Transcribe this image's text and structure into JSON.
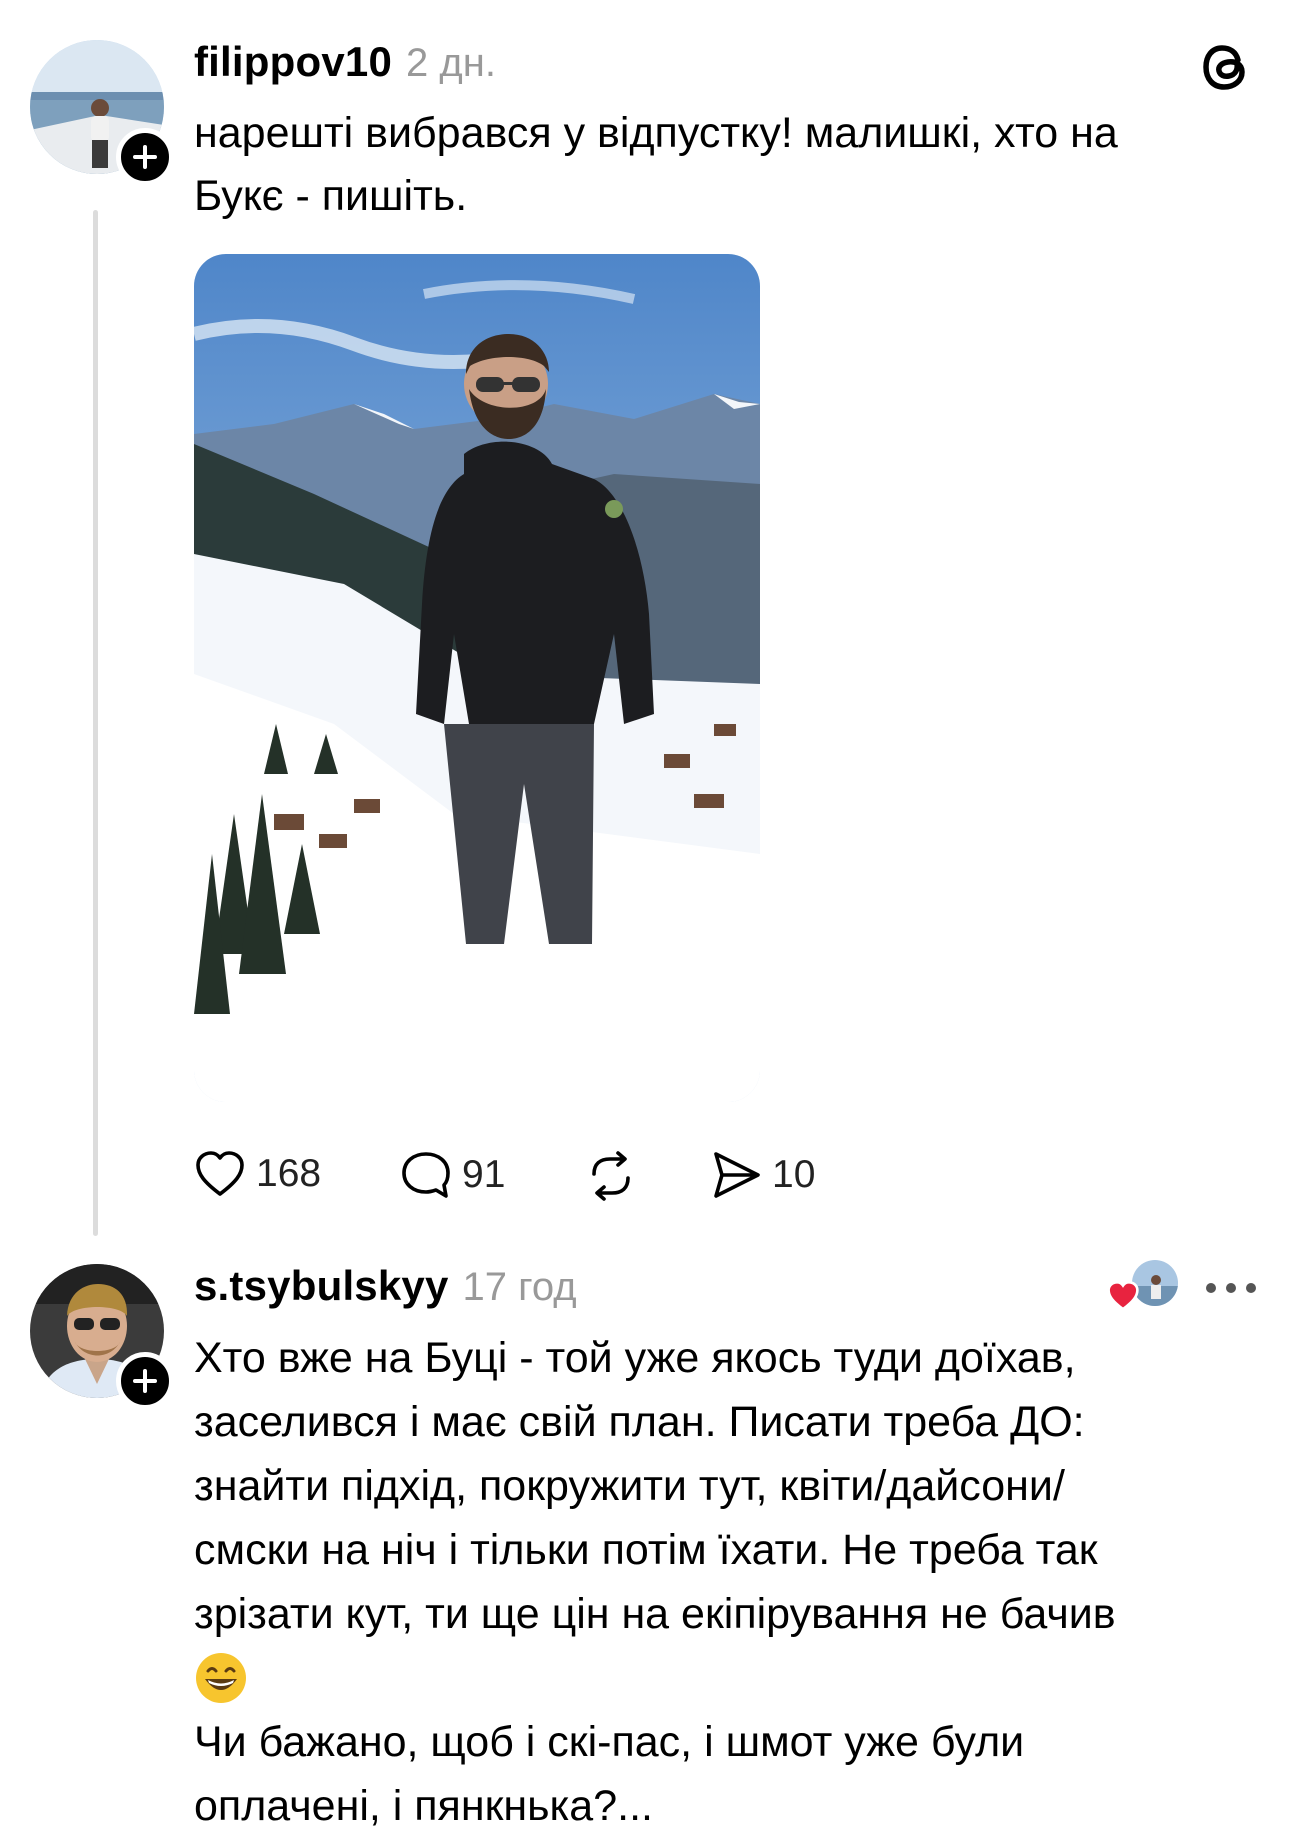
{
  "post": {
    "username": "filippov10",
    "time": "2 дн.",
    "text_line1": "нарешті вибрався у відпустку! малишкі, хто на",
    "text_line2": "Букє - пишіть.",
    "actions": {
      "likes": "168",
      "comments": "91",
      "shares": "10"
    }
  },
  "reply": {
    "username": "s.tsybulskyy",
    "time": "17 год",
    "lines": [
      "Хто вже на Буці - той уже якось туди доїхав,",
      "заселився і має свій план. Писати треба ДО:",
      "знайти підхід, покружити тут, квіти/дайсони/",
      "смски на ніч і тільки потім їхати. Не треба так",
      "зрізати кут, ти ще цін на екіпірування не бачив"
    ],
    "emoji": "😄",
    "lines2": [
      "Чи бажано, щоб і скі-пас, і шмот уже були",
      "оплачені, і пянкнька?..."
    ]
  },
  "colors": {
    "text": "#000000",
    "muted": "#999999",
    "line": "#dcdcdc",
    "heart": "#e8233f"
  },
  "icons": [
    "threads-logo-icon",
    "heart-icon",
    "comment-icon",
    "repost-icon",
    "share-icon",
    "plus-icon",
    "more-icon"
  ]
}
